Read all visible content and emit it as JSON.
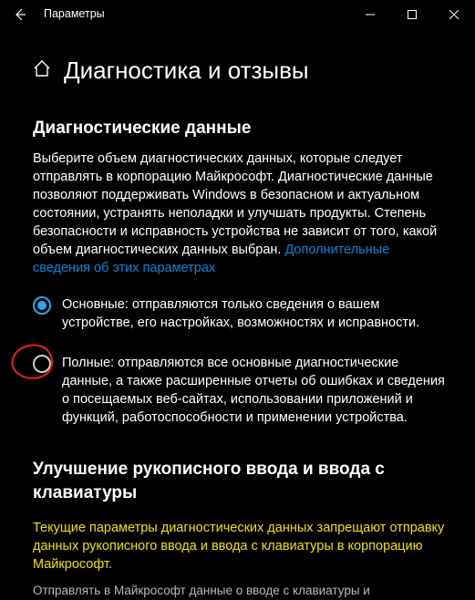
{
  "titlebar": {
    "app_title": "Параметры"
  },
  "header": {
    "title": "Диагностика и отзывы"
  },
  "section1": {
    "heading": "Диагностические данные",
    "desc": "Выберите объем диагностических данных, которые следует отправлять в корпорацию Майкрософт. Диагностические данные позволяют поддерживать Windows в безопасном и актуальном состоянии, устранять неполадки и улучшать продукты. Степень безопасности и исправность устройства не зависит от того, какой объем диагностических данных выбран. ",
    "link_text": "Дополнительные сведения об этих параметрах",
    "options": {
      "basic": "Основные: отправляются только сведения о вашем устройстве, его настройках, возможностях и исправности.",
      "full": "Полные: отправляются все основные диагностические данные, а также расширенные отчеты об ошибках и сведения о посещаемых веб-сайтах, использовании приложений и функций, работоспособности и применении устройства."
    }
  },
  "section2": {
    "heading": "Улучшение рукописного ввода и ввода с клавиатуры",
    "warning": "Текущие параметры диагностических данных запрещают отправку данных рукописного ввода и ввода с клавиатуры в корпорацию Майкрософт.",
    "cutoff": "Отправлять в Майкрософт данные о вводе с клавиатуры и"
  }
}
